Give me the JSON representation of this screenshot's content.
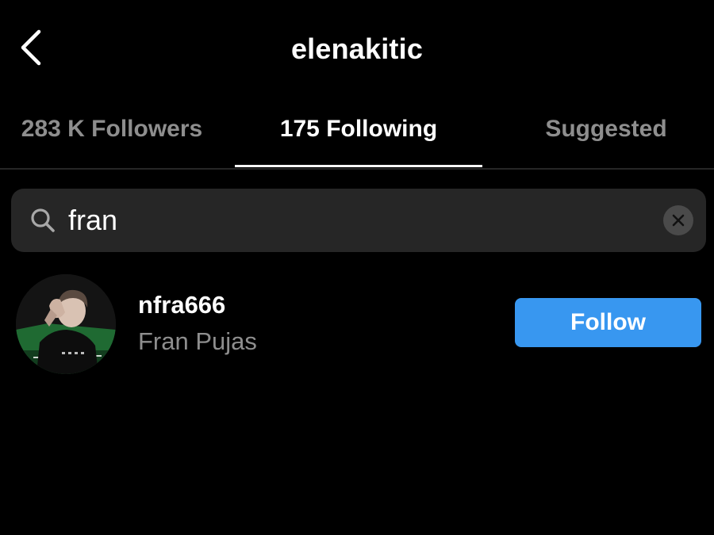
{
  "header": {
    "title": "elenakitic",
    "back_icon": "chevron-left-icon"
  },
  "tabs": [
    {
      "label": "283 K Followers",
      "active": false
    },
    {
      "label": "175 Following",
      "active": true
    },
    {
      "label": "Suggested",
      "active": false
    }
  ],
  "search": {
    "value": "fran",
    "icon": "search-icon",
    "clear_icon": "clear-icon"
  },
  "results": [
    {
      "username": "nfra666",
      "full_name": "Fran Pujas",
      "follow_label": "Follow"
    }
  ],
  "colors": {
    "background": "#000000",
    "primary_text": "#ffffff",
    "secondary_text": "#8e8e8e",
    "search_background": "#262626",
    "follow_button": "#3897f0"
  }
}
